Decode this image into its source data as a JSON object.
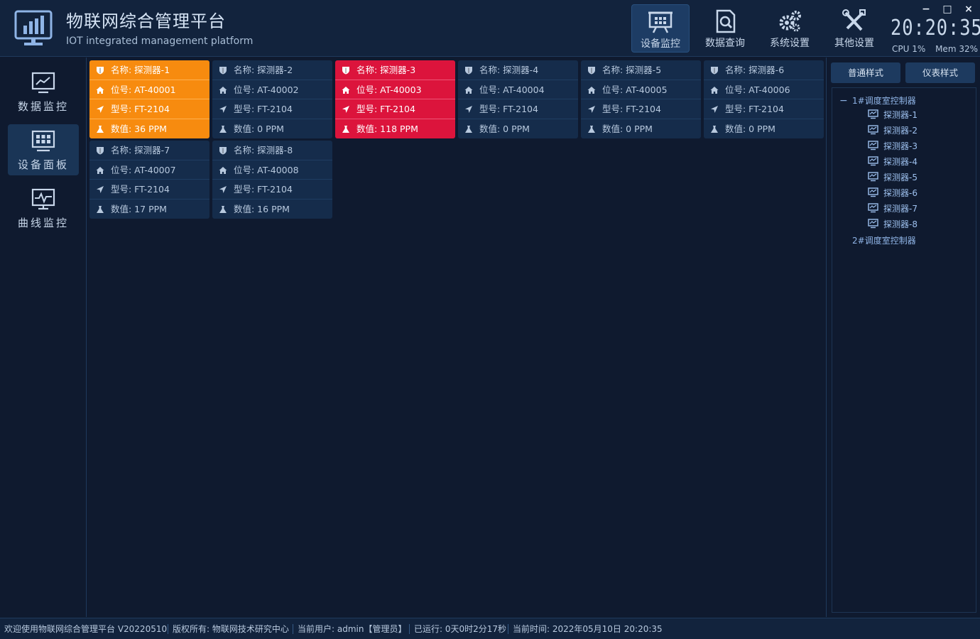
{
  "app": {
    "title": "物联网综合管理平台",
    "subtitle": "IOT integrated management platform"
  },
  "topnav": {
    "items": [
      {
        "label": "设备监控",
        "icon": "presentation-board-icon",
        "active": true
      },
      {
        "label": "数据查询",
        "icon": "document-search-icon",
        "active": false
      },
      {
        "label": "系统设置",
        "icon": "gears-icon",
        "active": false
      },
      {
        "label": "其他设置",
        "icon": "tools-icon",
        "active": false
      }
    ]
  },
  "window_controls": {
    "minimize": "−",
    "maximize": "□",
    "close": "×"
  },
  "clock": {
    "time": "20:20:35"
  },
  "sys_stats": {
    "cpu": "CPU 1%",
    "mem": "Mem 32%"
  },
  "sidenav": {
    "items": [
      {
        "label": "数据监控",
        "icon": "line-chart-monitor-icon",
        "active": false
      },
      {
        "label": "设备面板",
        "icon": "grid-panel-icon",
        "active": true
      },
      {
        "label": "曲线监控",
        "icon": "pulse-monitor-icon",
        "active": false
      }
    ]
  },
  "devices": [
    {
      "name": "名称: 探测器-1",
      "position": "位号: AT-40001",
      "model": "型号: FT-2104",
      "value": "数值: 36 PPM",
      "status": "warn"
    },
    {
      "name": "名称: 探测器-2",
      "position": "位号: AT-40002",
      "model": "型号: FT-2104",
      "value": "数值: 0 PPM",
      "status": "normal"
    },
    {
      "name": "名称: 探测器-3",
      "position": "位号: AT-40003",
      "model": "型号: FT-2104",
      "value": "数值: 118 PPM",
      "status": "alarm"
    },
    {
      "name": "名称: 探测器-4",
      "position": "位号: AT-40004",
      "model": "型号: FT-2104",
      "value": "数值: 0 PPM",
      "status": "normal"
    },
    {
      "name": "名称: 探测器-5",
      "position": "位号: AT-40005",
      "model": "型号: FT-2104",
      "value": "数值: 0 PPM",
      "status": "normal"
    },
    {
      "name": "名称: 探测器-6",
      "position": "位号: AT-40006",
      "model": "型号: FT-2104",
      "value": "数值: 0 PPM",
      "status": "normal"
    },
    {
      "name": "名称: 探测器-7",
      "position": "位号: AT-40007",
      "model": "型号: FT-2104",
      "value": "数值: 17 PPM",
      "status": "normal"
    },
    {
      "name": "名称: 探测器-8",
      "position": "位号: AT-40008",
      "model": "型号: FT-2104",
      "value": "数值: 16 PPM",
      "status": "normal"
    }
  ],
  "colors": {
    "warn": "#f78b0f",
    "alarm": "#dc143c",
    "normal": "#152c4b",
    "accent": "#8fb4e6"
  },
  "right_panel": {
    "buttons": [
      "普通样式",
      "仪表样式"
    ],
    "tree": {
      "toggle": "−",
      "root1": "1#调度室控制器",
      "children": [
        "探测器-1",
        "探测器-2",
        "探测器-3",
        "探测器-4",
        "探测器-5",
        "探测器-6",
        "探测器-7",
        "探测器-8"
      ],
      "root2": "2#调度室控制器"
    }
  },
  "statusbar": {
    "welcome": "欢迎使用物联网综合管理平台 V20220510",
    "copyright": "版权所有: 物联网技术研究中心",
    "user": "当前用户: admin【管理员】",
    "uptime": "已运行: 0天0时2分17秒",
    "time": "当前时间: 2022年05月10日 20:20:35"
  }
}
